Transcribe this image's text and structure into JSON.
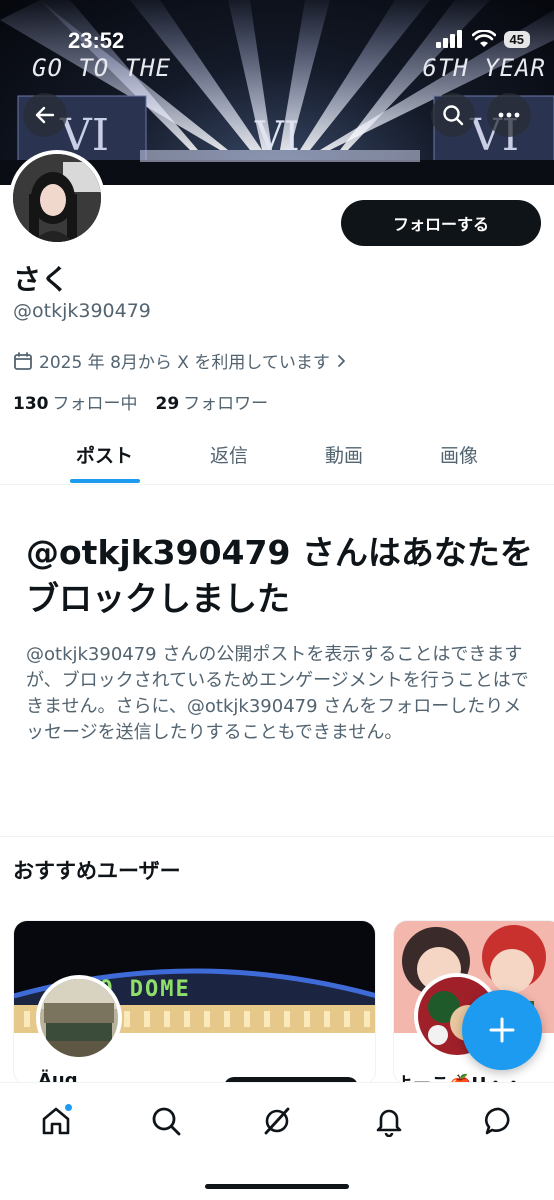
{
  "status_bar": {
    "time": "23:52",
    "battery": "45"
  },
  "banner": {
    "text_left": "GO TO THE",
    "text_right": "6TH YEAR"
  },
  "profile": {
    "display_name": "さく",
    "handle": "@otkjk390479",
    "joined": "2025 年 8月から X を利用しています",
    "following_count": "130",
    "following_label": "フォロー中",
    "followers_count": "29",
    "followers_label": "フォロワー",
    "follow_button": "フォローする"
  },
  "tabs": [
    {
      "label": "ポスト",
      "active": true
    },
    {
      "label": "返信",
      "active": false
    },
    {
      "label": "動画",
      "active": false
    },
    {
      "label": "画像",
      "active": false
    }
  ],
  "blocked": {
    "title": "@otkjk390479 さんはあなたをブロックしました",
    "description": "@otkjk390479 さんの公開ポストを表示することはできますが、ブロックされているためエンゲージメントを行うことはできません。さらに、@otkjk390479 さんをフォローしたりメッセージを送信したりすることもできません。"
  },
  "recommended": {
    "title": "おすすめユーザー",
    "cards": [
      {
        "name": "Äug",
        "image_text": "YO DOME"
      },
      {
        "name": "よーこ🍎H・・"
      }
    ]
  },
  "colors": {
    "accent": "#1d9bf0",
    "text": "#0f1419",
    "secondary_text": "#536471"
  },
  "icons": {
    "back": "arrow-left-icon",
    "search": "search-icon",
    "more": "more-icon",
    "calendar": "calendar-icon",
    "compose": "plus-icon",
    "nav": [
      "home-icon",
      "search-icon",
      "grok-icon",
      "bell-icon",
      "message-icon"
    ]
  }
}
